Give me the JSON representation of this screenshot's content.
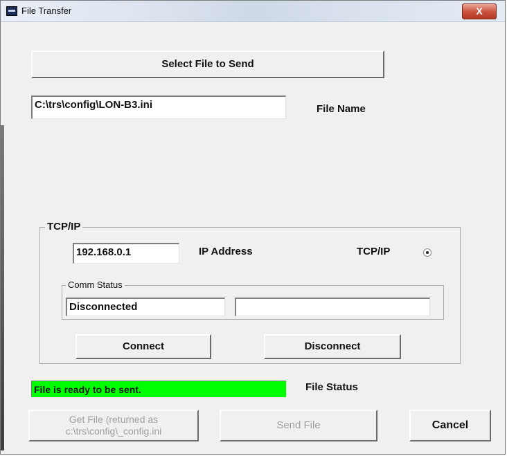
{
  "window": {
    "title": "File Transfer",
    "close_glyph": "X",
    "icon": "app-icon"
  },
  "file": {
    "select_button": "Select File to Send",
    "path_value": "C:\\trs\\config\\LON-B3.ini",
    "name_label": "File Name"
  },
  "tcpip": {
    "group_label": "TCP/IP",
    "ip_value": "192.168.0.1",
    "ip_label": "IP Address",
    "radio_label": "TCP/IP",
    "radio_selected": true,
    "comm_status_label": "Comm Status",
    "status_value": "Disconnected",
    "status_detail": "",
    "connect_button": "Connect",
    "disconnect_button": "Disconnect"
  },
  "status": {
    "message": "File is ready to be sent.",
    "label": "File Status",
    "color": "#00ff00"
  },
  "actions": {
    "get_file_line1": "Get File (returned as",
    "get_file_line2": "c:\\trs\\config\\_config.ini",
    "send_file": "Send File",
    "cancel": "Cancel"
  }
}
